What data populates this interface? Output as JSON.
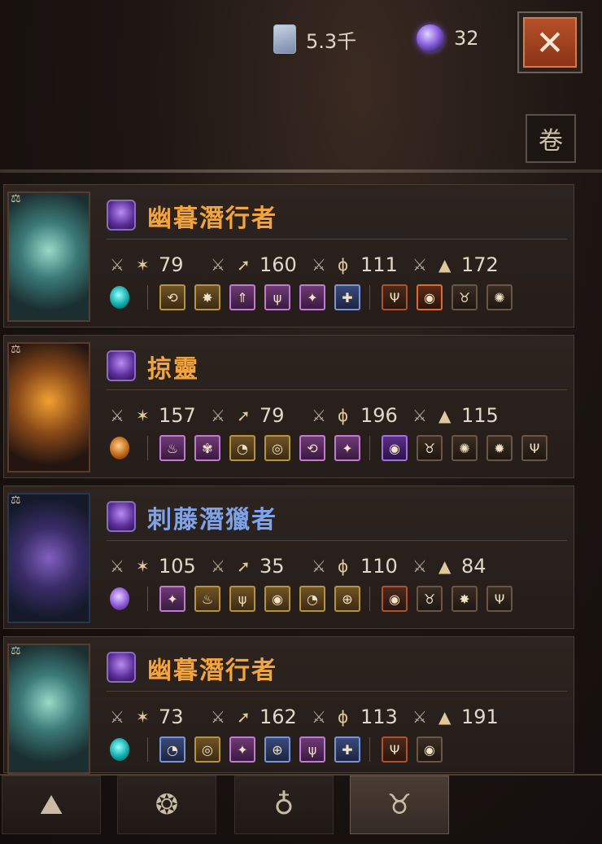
{
  "currency": {
    "shards": {
      "value": "5.3千",
      "icon": "ticket-icon"
    },
    "orbs": {
      "value": "32",
      "icon": "purple-orb-icon"
    }
  },
  "buttons": {
    "close_symbol": "✕",
    "scroll_symbol": "卷"
  },
  "pets": [
    {
      "name": "幽暮潛行者",
      "name_color": "#f4a43c",
      "stats": [
        "79",
        "160",
        "111",
        "172"
      ],
      "gem": "teal",
      "skills_primary": 6,
      "skills_secondary": 4
    },
    {
      "name": "掠靈",
      "name_color": "#f4a43c",
      "stats": [
        "157",
        "79",
        "196",
        "115"
      ],
      "gem": "amber",
      "skills_primary": 6,
      "skills_secondary": 5
    },
    {
      "name": "刺藤潛獵者",
      "name_color": "#7fa3ea",
      "stats": [
        "105",
        "35",
        "110",
        "84"
      ],
      "gem": "violet",
      "skills_primary": 6,
      "skills_secondary": 4
    },
    {
      "name": "幽暮潛行者",
      "name_color": "#f4a43c",
      "stats": [
        "73",
        "162",
        "113",
        "191"
      ],
      "gem": "teal",
      "skills_primary": 6,
      "skills_secondary": 2
    }
  ],
  "tabs": [
    "rock-icon",
    "swirl-emblem-icon",
    "pouch-icon",
    "horned-beast-icon"
  ],
  "active_tab": 3
}
